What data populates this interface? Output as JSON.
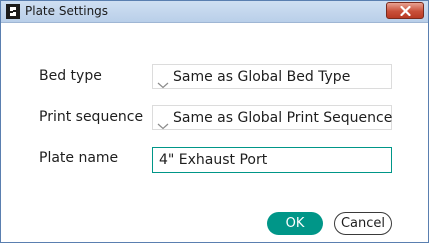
{
  "window": {
    "title": "Plate Settings"
  },
  "fields": {
    "bed_type": {
      "label": "Bed type",
      "value": "Same as Global Bed Type"
    },
    "print_sequence": {
      "label": "Print sequence",
      "value": "Same as Global Print Sequence"
    },
    "plate_name": {
      "label": "Plate name",
      "value": "4\" Exhaust Port"
    }
  },
  "buttons": {
    "ok_label": "OK",
    "cancel_label": "Cancel"
  },
  "icons": {
    "app": "app-logo-icon",
    "close": "close-icon",
    "dropdown": "chevron-down-icon"
  },
  "colors": {
    "accent": "#009688",
    "titlebar": "#c4d7ee",
    "close_button": "#c9503a"
  }
}
